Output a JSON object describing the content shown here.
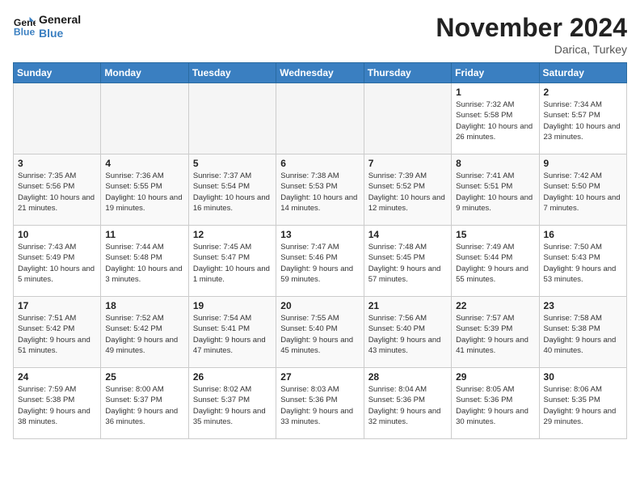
{
  "header": {
    "logo_line1": "General",
    "logo_line2": "Blue",
    "month": "November 2024",
    "location": "Darica, Turkey"
  },
  "weekdays": [
    "Sunday",
    "Monday",
    "Tuesday",
    "Wednesday",
    "Thursday",
    "Friday",
    "Saturday"
  ],
  "weeks": [
    [
      {
        "day": "",
        "info": ""
      },
      {
        "day": "",
        "info": ""
      },
      {
        "day": "",
        "info": ""
      },
      {
        "day": "",
        "info": ""
      },
      {
        "day": "",
        "info": ""
      },
      {
        "day": "1",
        "info": "Sunrise: 7:32 AM\nSunset: 5:58 PM\nDaylight: 10 hours and 26 minutes."
      },
      {
        "day": "2",
        "info": "Sunrise: 7:34 AM\nSunset: 5:57 PM\nDaylight: 10 hours and 23 minutes."
      }
    ],
    [
      {
        "day": "3",
        "info": "Sunrise: 7:35 AM\nSunset: 5:56 PM\nDaylight: 10 hours and 21 minutes."
      },
      {
        "day": "4",
        "info": "Sunrise: 7:36 AM\nSunset: 5:55 PM\nDaylight: 10 hours and 19 minutes."
      },
      {
        "day": "5",
        "info": "Sunrise: 7:37 AM\nSunset: 5:54 PM\nDaylight: 10 hours and 16 minutes."
      },
      {
        "day": "6",
        "info": "Sunrise: 7:38 AM\nSunset: 5:53 PM\nDaylight: 10 hours and 14 minutes."
      },
      {
        "day": "7",
        "info": "Sunrise: 7:39 AM\nSunset: 5:52 PM\nDaylight: 10 hours and 12 minutes."
      },
      {
        "day": "8",
        "info": "Sunrise: 7:41 AM\nSunset: 5:51 PM\nDaylight: 10 hours and 9 minutes."
      },
      {
        "day": "9",
        "info": "Sunrise: 7:42 AM\nSunset: 5:50 PM\nDaylight: 10 hours and 7 minutes."
      }
    ],
    [
      {
        "day": "10",
        "info": "Sunrise: 7:43 AM\nSunset: 5:49 PM\nDaylight: 10 hours and 5 minutes."
      },
      {
        "day": "11",
        "info": "Sunrise: 7:44 AM\nSunset: 5:48 PM\nDaylight: 10 hours and 3 minutes."
      },
      {
        "day": "12",
        "info": "Sunrise: 7:45 AM\nSunset: 5:47 PM\nDaylight: 10 hours and 1 minute."
      },
      {
        "day": "13",
        "info": "Sunrise: 7:47 AM\nSunset: 5:46 PM\nDaylight: 9 hours and 59 minutes."
      },
      {
        "day": "14",
        "info": "Sunrise: 7:48 AM\nSunset: 5:45 PM\nDaylight: 9 hours and 57 minutes."
      },
      {
        "day": "15",
        "info": "Sunrise: 7:49 AM\nSunset: 5:44 PM\nDaylight: 9 hours and 55 minutes."
      },
      {
        "day": "16",
        "info": "Sunrise: 7:50 AM\nSunset: 5:43 PM\nDaylight: 9 hours and 53 minutes."
      }
    ],
    [
      {
        "day": "17",
        "info": "Sunrise: 7:51 AM\nSunset: 5:42 PM\nDaylight: 9 hours and 51 minutes."
      },
      {
        "day": "18",
        "info": "Sunrise: 7:52 AM\nSunset: 5:42 PM\nDaylight: 9 hours and 49 minutes."
      },
      {
        "day": "19",
        "info": "Sunrise: 7:54 AM\nSunset: 5:41 PM\nDaylight: 9 hours and 47 minutes."
      },
      {
        "day": "20",
        "info": "Sunrise: 7:55 AM\nSunset: 5:40 PM\nDaylight: 9 hours and 45 minutes."
      },
      {
        "day": "21",
        "info": "Sunrise: 7:56 AM\nSunset: 5:40 PM\nDaylight: 9 hours and 43 minutes."
      },
      {
        "day": "22",
        "info": "Sunrise: 7:57 AM\nSunset: 5:39 PM\nDaylight: 9 hours and 41 minutes."
      },
      {
        "day": "23",
        "info": "Sunrise: 7:58 AM\nSunset: 5:38 PM\nDaylight: 9 hours and 40 minutes."
      }
    ],
    [
      {
        "day": "24",
        "info": "Sunrise: 7:59 AM\nSunset: 5:38 PM\nDaylight: 9 hours and 38 minutes."
      },
      {
        "day": "25",
        "info": "Sunrise: 8:00 AM\nSunset: 5:37 PM\nDaylight: 9 hours and 36 minutes."
      },
      {
        "day": "26",
        "info": "Sunrise: 8:02 AM\nSunset: 5:37 PM\nDaylight: 9 hours and 35 minutes."
      },
      {
        "day": "27",
        "info": "Sunrise: 8:03 AM\nSunset: 5:36 PM\nDaylight: 9 hours and 33 minutes."
      },
      {
        "day": "28",
        "info": "Sunrise: 8:04 AM\nSunset: 5:36 PM\nDaylight: 9 hours and 32 minutes."
      },
      {
        "day": "29",
        "info": "Sunrise: 8:05 AM\nSunset: 5:36 PM\nDaylight: 9 hours and 30 minutes."
      },
      {
        "day": "30",
        "info": "Sunrise: 8:06 AM\nSunset: 5:35 PM\nDaylight: 9 hours and 29 minutes."
      }
    ]
  ]
}
